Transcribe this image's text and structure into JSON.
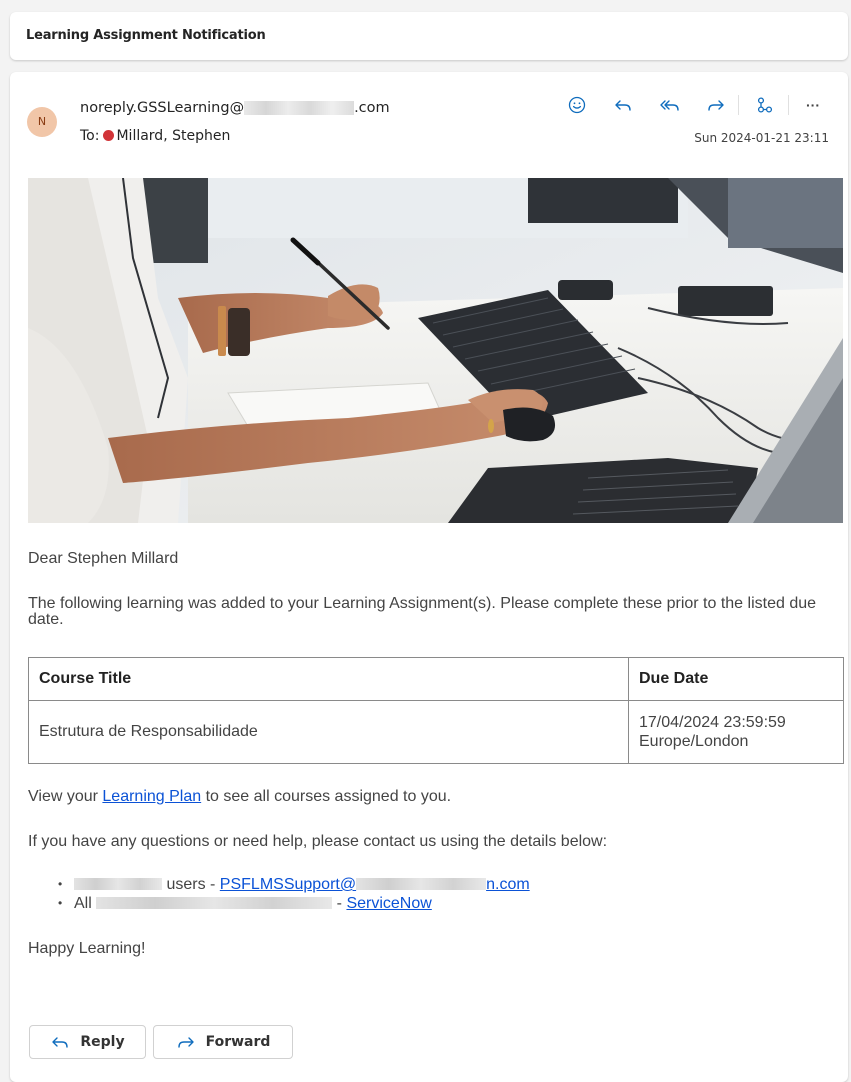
{
  "subject": "Learning Assignment Notification",
  "header": {
    "avatar_initial": "N",
    "sender_prefix": "noreply.GSSLearning@",
    "sender_suffix": ".com",
    "to_label": "To:",
    "recipient": "Millard, Stephen",
    "timestamp": "Sun 2024-01-21 23:11",
    "recipient_status_color": "#d13438",
    "toolbar_icons": [
      "smiley-icon",
      "reply-icon",
      "reply-all-icon",
      "forward-icon",
      "apps-icon",
      "more-icon"
    ],
    "more_label": "···"
  },
  "body": {
    "greeting": "Dear Stephen Millard",
    "intro": "The following learning was added to your Learning Assignment(s). Please complete these prior to the listed due date.",
    "table": {
      "headers": [
        "Course Title",
        "Due Date"
      ],
      "rows": [
        {
          "title": "Estrutura de Responsabilidade",
          "due_date": "17/04/2024 23:59:59",
          "due_tz": "Europe/London"
        }
      ]
    },
    "view_prefix": "View your ",
    "view_link": "Learning Plan",
    "view_suffix": " to see all courses assigned to you.",
    "questions": "If you have any questions or need help, please contact us using the details below:",
    "contacts": [
      {
        "text": " users - ",
        "link": "PSFLMSSupport@",
        "link_tail": "n.com"
      },
      {
        "text_prefix": "All ",
        "text": " - ",
        "link": "ServiceNow"
      }
    ],
    "signoff": "Happy Learning!"
  },
  "actions": {
    "reply": "Reply",
    "forward": "Forward"
  },
  "colors": {
    "link": "#0b52d6",
    "accent": "#0f6cbd"
  }
}
